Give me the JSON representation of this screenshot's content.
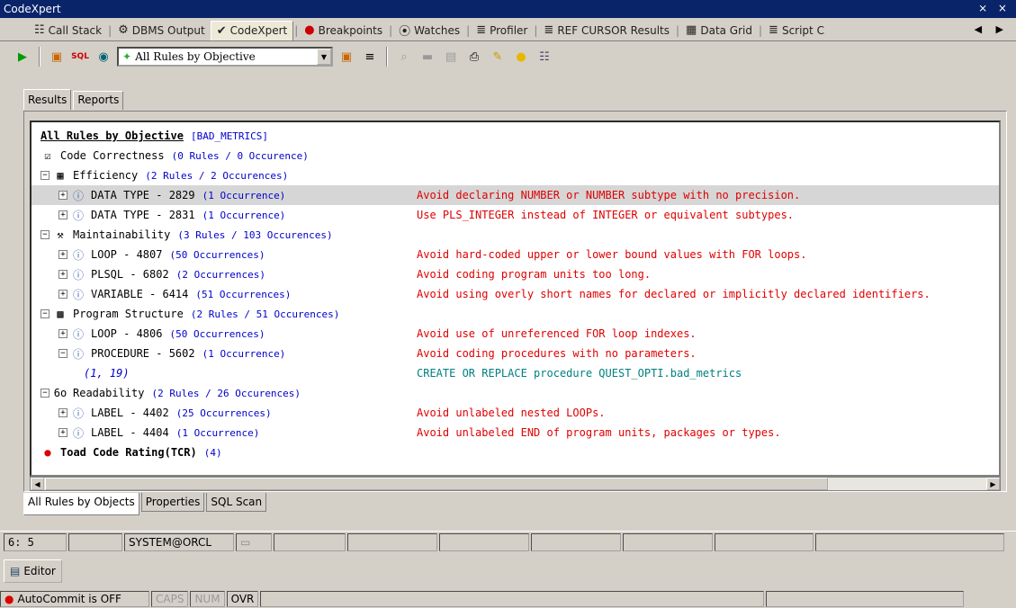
{
  "window": {
    "title": "CodeXpert",
    "controls": "⨯ ×"
  },
  "tabs": [
    {
      "label": "Call Stack",
      "icon": "☷"
    },
    {
      "label": "DBMS Output",
      "icon": "⚙"
    },
    {
      "label": "CodeXpert",
      "icon": "✔",
      "active": true
    },
    {
      "label": "Breakpoints",
      "icon": "●"
    },
    {
      "label": "Watches",
      "icon": "⦿"
    },
    {
      "label": "Profiler",
      "icon": "≣"
    },
    {
      "label": "REF CURSOR Results",
      "icon": "≣"
    },
    {
      "label": "Data Grid",
      "icon": "▦"
    },
    {
      "label": "Script C",
      "icon": "≣"
    }
  ],
  "toolbar": {
    "combo_value": "All Rules by Objective"
  },
  "panel_tabs": [
    "Results",
    "Reports"
  ],
  "tree": {
    "rows": [
      {
        "level": 0,
        "name": "All Rules by Objective",
        "count": "[BAD_METRICS]",
        "bold": true,
        "underline": true
      },
      {
        "level": 0,
        "icon": "☑",
        "name": "Code Correctness",
        "count": "(0 Rules / 0 Occurence)"
      },
      {
        "level": 0,
        "expander": "−",
        "icon": "▦",
        "name": "Efficiency",
        "count": "(2 Rules / 2 Occurences)"
      },
      {
        "level": 1,
        "expander": "+",
        "icon": "ⓘ",
        "name": "DATA TYPE - 2829",
        "count": "(1 Occurrence)",
        "desc": "Avoid declaring NUMBER or NUMBER subtype with no precision.",
        "selected": true
      },
      {
        "level": 1,
        "expander": "+",
        "icon": "ⓘ",
        "name": "DATA TYPE - 2831",
        "count": "(1 Occurrence)",
        "desc": "Use PLS_INTEGER instead of INTEGER or equivalent subtypes."
      },
      {
        "level": 0,
        "expander": "−",
        "icon": "⚒",
        "name": "Maintainability",
        "count": "(3 Rules / 103 Occurences)"
      },
      {
        "level": 1,
        "expander": "+",
        "icon": "ⓘ",
        "name": "LOOP - 4807",
        "count": "(50 Occurrences)",
        "desc": "Avoid hard-coded upper or lower bound values with FOR loops."
      },
      {
        "level": 1,
        "expander": "+",
        "icon": "ⓘ",
        "name": "PLSQL - 6802",
        "count": "(2 Occurrences)",
        "desc": "Avoid coding program units too long."
      },
      {
        "level": 1,
        "expander": "+",
        "icon": "ⓘ",
        "name": "VARIABLE - 6414",
        "count": "(51 Occurrences)",
        "desc": "Avoid using overly short names for declared or implicitly declared identifiers."
      },
      {
        "level": 0,
        "expander": "−",
        "icon": "▩",
        "name": "Program Structure",
        "count": "(2 Rules / 51 Occurences)"
      },
      {
        "level": 1,
        "expander": "+",
        "icon": "ⓘ",
        "name": "LOOP - 4806",
        "count": "(50 Occurrences)",
        "desc": "Avoid use of unreferenced FOR loop indexes."
      },
      {
        "level": 1,
        "expander": "−",
        "icon": "ⓘ",
        "name": "PROCEDURE - 5602",
        "count": "(1 Occurrence)",
        "desc": "Avoid coding procedures with no parameters."
      },
      {
        "level": 2,
        "link": "(1, 19)",
        "desc": "CREATE OR REPLACE procedure QUEST_OPTI.bad_metrics",
        "teal": true
      },
      {
        "level": 0,
        "expander": "−",
        "icon": "6o",
        "name": "Readability",
        "count": "(2 Rules / 26 Occurences)"
      },
      {
        "level": 1,
        "expander": "+",
        "icon": "ⓘ",
        "name": "LABEL - 4402",
        "count": "(25 Occurrences)",
        "desc": "Avoid unlabeled nested LOOPs."
      },
      {
        "level": 1,
        "expander": "+",
        "icon": "ⓘ",
        "name": "LABEL - 4404",
        "count": "(1 Occurrence)",
        "desc": "Avoid unlabeled END of program units, packages or types."
      },
      {
        "level": 0,
        "icon": "●",
        "name": "Toad Code Rating(TCR)",
        "count": "(4)",
        "bold": true,
        "red_icon": true
      }
    ]
  },
  "bottom_tabs": [
    "All Rules by Objects",
    "Properties",
    "SQL Scan"
  ],
  "status": {
    "position": "6: 5",
    "connection": "SYSTEM@ORCL"
  },
  "editor": {
    "label": "Editor"
  },
  "autocommit": {
    "text": "AutoCommit is OFF",
    "caps": "CAPS",
    "num": "NUM",
    "ovr": "OVR"
  },
  "colors": {
    "desc": "#e00000",
    "count": "#0000cc",
    "teal": "#008080",
    "title_bg": "#0a246a"
  }
}
